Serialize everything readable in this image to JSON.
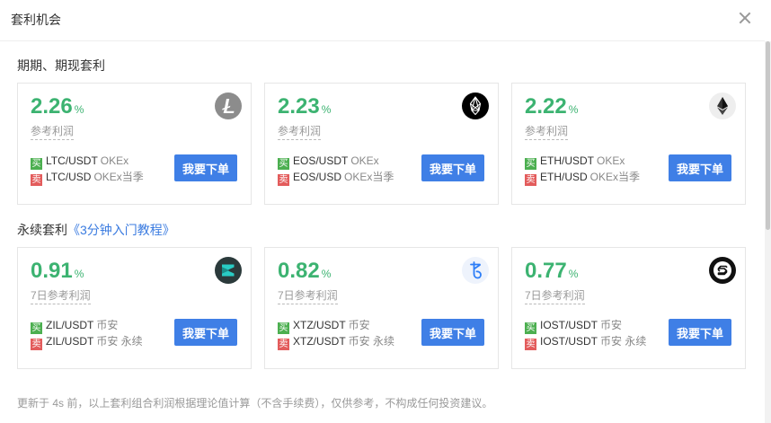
{
  "dialog": {
    "title": "套利机会"
  },
  "futures_section": {
    "title": "期期、期现套利",
    "cards": [
      {
        "rate": "2.26",
        "pct": "%",
        "sub_label": "参考利润",
        "buy_tag": "买",
        "buy_pair": "LTC/USDT",
        "buy_exchange": "OKEx",
        "sell_tag": "卖",
        "sell_pair": "LTC/USD",
        "sell_exchange": "OKEx当季",
        "button": "我要下单",
        "coin_icon": "litecoin-icon"
      },
      {
        "rate": "2.23",
        "pct": "%",
        "sub_label": "参考利润",
        "buy_tag": "买",
        "buy_pair": "EOS/USDT",
        "buy_exchange": "OKEx",
        "sell_tag": "卖",
        "sell_pair": "EOS/USD",
        "sell_exchange": "OKEx当季",
        "button": "我要下单",
        "coin_icon": "eos-icon"
      },
      {
        "rate": "2.22",
        "pct": "%",
        "sub_label": "参考利润",
        "buy_tag": "买",
        "buy_pair": "ETH/USDT",
        "buy_exchange": "OKEx",
        "sell_tag": "卖",
        "sell_pair": "ETH/USD",
        "sell_exchange": "OKEx当季",
        "button": "我要下单",
        "coin_icon": "ethereum-icon"
      }
    ]
  },
  "perpetual_section": {
    "title": "永续套利",
    "tutorial_link": "《3分钟入门教程》",
    "cards": [
      {
        "rate": "0.91",
        "pct": "%",
        "sub_label": "7日参考利润",
        "buy_tag": "买",
        "buy_pair": "ZIL/USDT",
        "buy_exchange": "币安",
        "sell_tag": "卖",
        "sell_pair": "ZIL/USDT",
        "sell_exchange": "币安 永续",
        "button": "我要下单",
        "coin_icon": "zilliqa-icon"
      },
      {
        "rate": "0.82",
        "pct": "%",
        "sub_label": "7日参考利润",
        "buy_tag": "买",
        "buy_pair": "XTZ/USDT",
        "buy_exchange": "币安",
        "sell_tag": "卖",
        "sell_pair": "XTZ/USDT",
        "sell_exchange": "币安 永续",
        "button": "我要下单",
        "coin_icon": "tezos-icon"
      },
      {
        "rate": "0.77",
        "pct": "%",
        "sub_label": "7日参考利润",
        "buy_tag": "买",
        "buy_pair": "IOST/USDT",
        "buy_exchange": "币安",
        "sell_tag": "卖",
        "sell_pair": "IOST/USDT",
        "sell_exchange": "币安 永续",
        "button": "我要下单",
        "coin_icon": "iost-icon"
      }
    ]
  },
  "footer": {
    "note": "更新于 4s 前，以上套利组合利润根据理论值计算（不含手续费），仅供参考，不构成任何投资建议。"
  },
  "colors": {
    "rate_green": "#3cb371",
    "button_blue": "#3f7fe6",
    "buy_tag": "#4caf50",
    "sell_tag": "#e35c5c",
    "link_blue": "#3a7be0"
  }
}
